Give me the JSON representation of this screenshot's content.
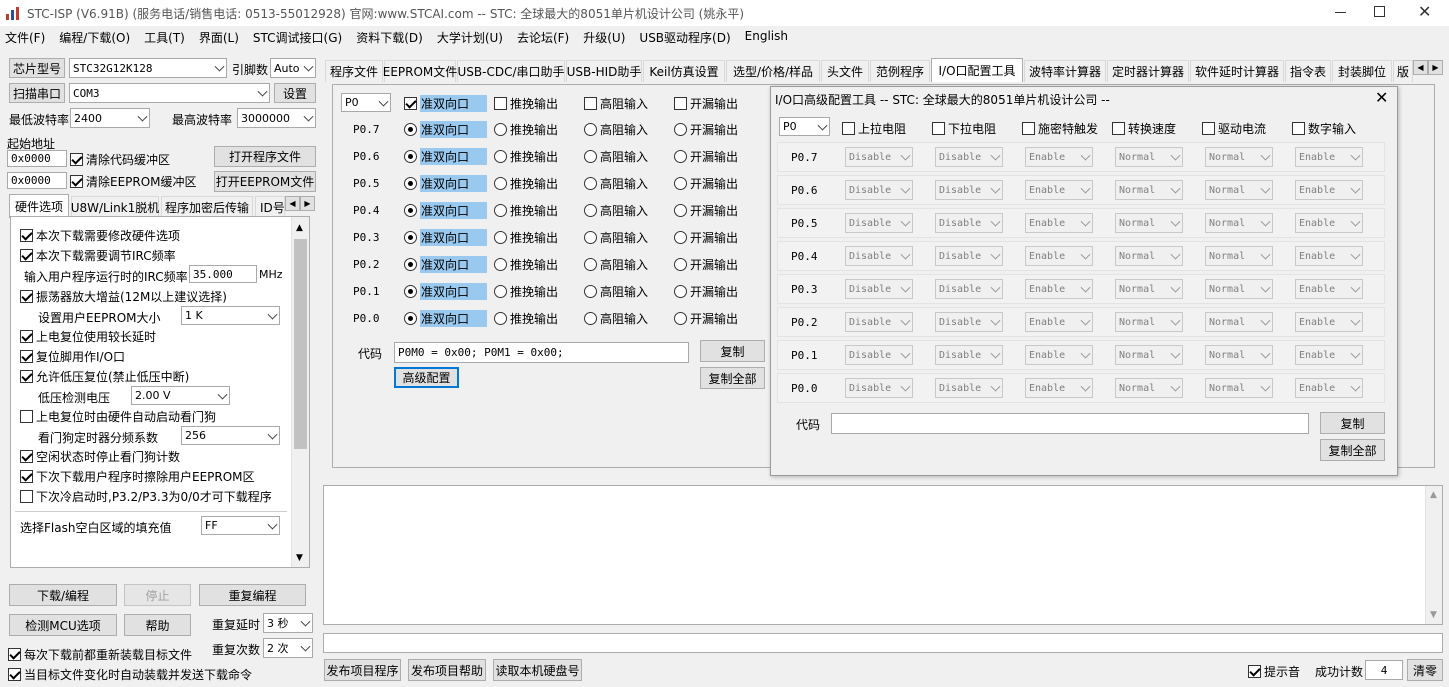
{
  "title": "STC-ISP (V6.91B) (服务电话/销售电话: 0513-55012928) 官网:www.STCAI.com  -- STC: 全球最大的8051单片机设计公司 (姚永平)",
  "menu": [
    "文件(F)",
    "编程/下载(O)",
    "工具(T)",
    "界面(L)",
    "STC调试接口(G)",
    "资料下载(D)",
    "大学计划(U)",
    "去论坛(F)",
    "升级(U)",
    "USB驱动程序(D)",
    "English"
  ],
  "left": {
    "chip_label": "芯片型号",
    "chip_value": "STC32G12K128",
    "pins_label": "引脚数",
    "pins_value": "Auto",
    "scan_button": "扫描串口",
    "port_value": "COM3",
    "settings_button": "设置",
    "min_baud_label": "最低波特率",
    "min_baud_value": "2400",
    "max_baud_label": "最高波特率",
    "max_baud_value": "3000000",
    "start_addr_label": "起始地址",
    "addr1": "0x0000",
    "clear_code": "清除代码缓冲区",
    "open_prog": "打开程序文件",
    "addr2": "0x0000",
    "clear_eeprom": "清除EEPROM缓冲区",
    "open_eeprom": "打开EEPROM文件",
    "tabs": [
      "硬件选项",
      "U8W/Link1脱机",
      "程序加密后传输",
      "ID号"
    ],
    "options": [
      {
        "text": "本次下载需要修改硬件选项",
        "checked": true
      },
      {
        "text": "本次下载需要调节IRC频率",
        "checked": true
      },
      {
        "text": "输入用户程序运行时的IRC频率",
        "value": "35.000",
        "unit": "MHz"
      },
      {
        "text": "振荡器放大增益(12M以上建议选择)",
        "checked": true
      },
      {
        "text": "设置用户EEPROM大小",
        "value": "1   K"
      },
      {
        "text": "上电复位使用较长延时",
        "checked": true
      },
      {
        "text": "复位脚用作I/O口",
        "checked": true
      },
      {
        "text": "允许低压复位(禁止低压中断)",
        "checked": true
      },
      {
        "text": "低压检测电压",
        "value": "2.00 V"
      },
      {
        "text": "上电复位时由硬件自动启动看门狗",
        "checked": false
      },
      {
        "text": "看门狗定时器分频系数",
        "value": "256"
      },
      {
        "text": "空闲状态时停止看门狗计数",
        "checked": true
      },
      {
        "text": "下次下载用户程序时擦除用户EEPROM区",
        "checked": true
      },
      {
        "text": "下次冷启动时,P3.2/P3.3为0/0才可下载程序",
        "checked": false
      }
    ],
    "fill_label": "选择Flash空白区域的填充值",
    "fill_value": "FF",
    "download_button": "下载/编程",
    "stop_button": "停止",
    "reprogram_button": "重复编程",
    "detect_button": "检测MCU选项",
    "help_button": "帮助",
    "repeat_delay_label": "重复延时",
    "repeat_delay_value": "3 秒",
    "repeat_count_label": "重复次数",
    "repeat_count_value": "2 次",
    "reload_text": "每次下载前都重新装载目标文件",
    "auto_text": "当目标文件变化时自动装载并发送下载命令"
  },
  "right_tabs": [
    "程序文件",
    "EEPROM文件",
    "USB-CDC/串口助手",
    "USB-HID助手",
    "Keil仿真设置",
    "选型/价格/样品",
    "头文件",
    "范例程序",
    "I/O口配置工具",
    "波特率计算器",
    "定时器计算器",
    "软件延时计算器",
    "指令表",
    "封装脚位",
    "版"
  ],
  "io": {
    "port": "P0",
    "modes": [
      "准双向口",
      "推挽输出",
      "高阻输入",
      "开漏输出"
    ],
    "pins": [
      "P0.7",
      "P0.6",
      "P0.5",
      "P0.4",
      "P0.3",
      "P0.2",
      "P0.1",
      "P0.0"
    ],
    "code_label": "代码",
    "code_value": "P0M0 = 0x00;  P0M1 = 0x00;",
    "copy_button": "复制",
    "copy_all_button": "复制全部",
    "advanced_button": "高级配置"
  },
  "adv": {
    "title": "I/O口高级配置工具 -- STC: 全球最大的8051单片机设计公司 --",
    "port": "P0",
    "headers": [
      "上拉电阻",
      "下拉电阻",
      "施密特触发",
      "转换速度",
      "驱动电流",
      "数字输入"
    ],
    "values": [
      "Disable",
      "Disable",
      "Enable",
      "Normal",
      "Normal",
      "Enable"
    ],
    "pins": [
      "P0.7",
      "P0.6",
      "P0.5",
      "P0.4",
      "P0.3",
      "P0.2",
      "P0.1",
      "P0.0"
    ],
    "code_label": "代码",
    "copy_button": "复制",
    "copy_all_button": "复制全部"
  },
  "bottom": {
    "publish_prog": "发布项目程序",
    "publish_help": "发布项目帮助",
    "read_disk": "读取本机硬盘号",
    "sound_label": "提示音",
    "success_label": "成功计数",
    "success_value": "4",
    "clear_button": "清零"
  }
}
